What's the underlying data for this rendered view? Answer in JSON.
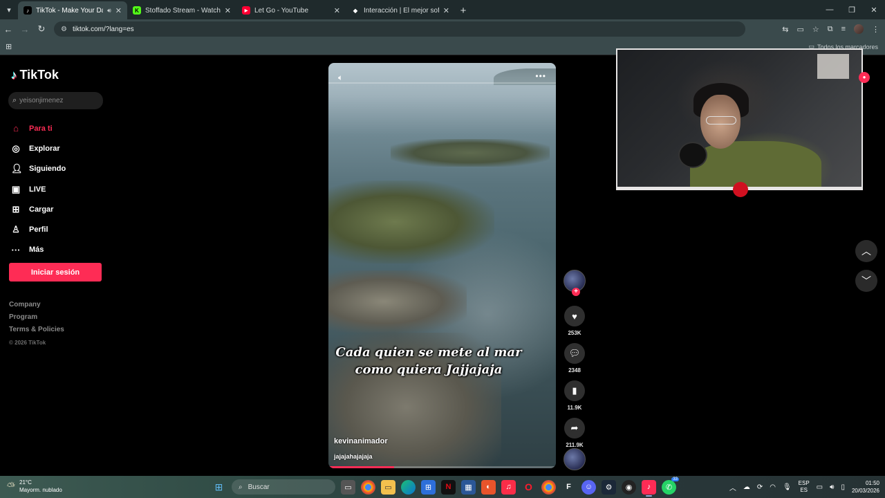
{
  "browser": {
    "tabs": [
      {
        "title": "TikTok - Make Your Day",
        "icon": "tiktok-icon",
        "active": true
      },
      {
        "title": "Stoffado Stream - Watch Live o",
        "icon": "kick-icon",
        "active": false
      },
      {
        "title": "Let Go - YouTube",
        "icon": "youtube-icon",
        "active": false
      },
      {
        "title": "Interacción | El mejor software p",
        "icon": "diamond-icon",
        "active": false
      }
    ],
    "url": "tiktok.com/?lang=es",
    "bookmarks_label": "Todos los marcadores"
  },
  "tiktok": {
    "brand": "TikTok",
    "search_placeholder": "yeisonjimenez",
    "nav": [
      {
        "label": "Para ti",
        "icon": "home-icon",
        "active": true
      },
      {
        "label": "Explorar",
        "icon": "compass-icon"
      },
      {
        "label": "Siguiendo",
        "icon": "following-icon"
      },
      {
        "label": "LIVE",
        "icon": "live-tv-icon"
      },
      {
        "label": "Cargar",
        "icon": "upload-icon"
      },
      {
        "label": "Perfil",
        "icon": "profile-icon"
      },
      {
        "label": "Más",
        "icon": "more-icon"
      }
    ],
    "login_label": "Iniciar sesión",
    "footer": [
      "Company",
      "Program",
      "Terms & Policies"
    ],
    "copyright": "© 2026 TikTok"
  },
  "video": {
    "caption_line1": "Cada quien se mete al mar",
    "caption_line2": "como quiera Jajjajaja",
    "author": "kevinanimador",
    "description": "jajajahajajaja",
    "progress": 0.29,
    "likes": "253K",
    "comments": "2348",
    "saves": "11.9K",
    "shares": "211.9K"
  },
  "taskbar": {
    "temperature": "21°C",
    "weather": "Mayorm. nublado",
    "search_label": "Buscar",
    "lang_top": "ESP",
    "lang_bottom": "ES",
    "time": "01:50",
    "date": "20/03/2026",
    "whatsapp_badge": "33"
  },
  "colors": {
    "tiktok_red": "#fe2c55",
    "chrome_bg": "#3a4a4c"
  }
}
